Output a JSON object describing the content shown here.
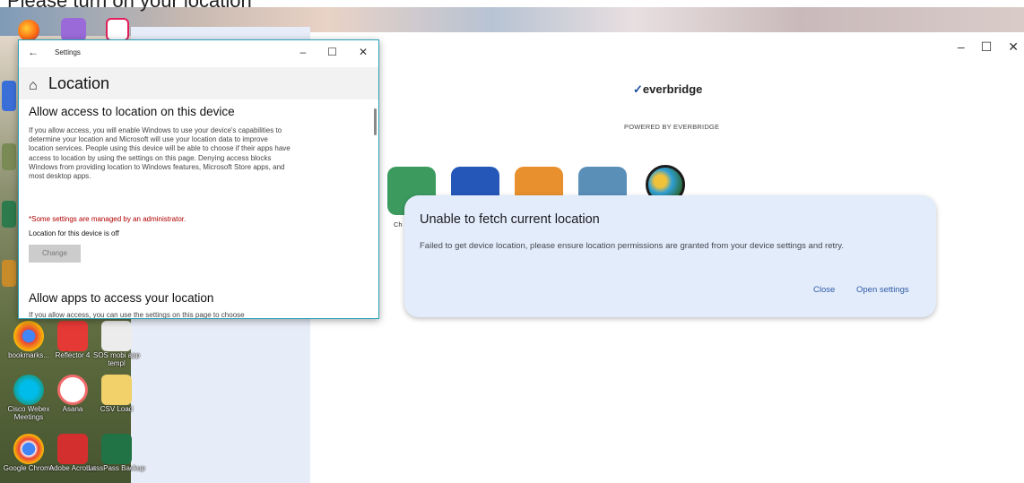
{
  "desktop": {
    "top_cut_text": "Please turn on your location",
    "icons": [
      {
        "label": "bookmarks...",
        "color": "#f4b400"
      },
      {
        "label": "Reflector 4",
        "color": "#e53935"
      },
      {
        "label": "SOS mobi app templ",
        "color": "#eaeaea"
      },
      {
        "label": "Cisco Webex Meetings",
        "color": "#2e7d32"
      },
      {
        "label": "Asana",
        "color": "#f06a6a"
      },
      {
        "label": "CSV Load",
        "color": "#f2d16b"
      },
      {
        "label": "Google Chrome",
        "color": "#4285f4"
      },
      {
        "label": "Adobe Acrobat",
        "color": "#d32f2f"
      },
      {
        "label": "LassPass Backup",
        "color": "#217346"
      }
    ]
  },
  "settings_window": {
    "title": "Settings",
    "back_icon": "←",
    "minimize_icon": "–",
    "maximize_icon": "☐",
    "close_icon": "✕",
    "home_icon": "⌂",
    "page_title": "Location",
    "section1_heading": "Allow access to location on this device",
    "section1_text": "If you allow access, you will enable Windows to use your device's capabilities to determine your location and Microsoft will use your location data to improve location services. People using this device will be able to choose if their apps have access to location by using the settings on this page. Denying access blocks Windows from providing location to Windows features, Microsoft Store apps, and most desktop apps.",
    "admin_warning": "*Some settings are managed by an administrator.",
    "device_status": "Location for this device is off",
    "change_button": "Change",
    "section2_heading": "Allow apps to access your location",
    "section2_text_cut": "If you allow access, you can use the settings on this page to choose"
  },
  "app_window": {
    "logo_text": "everbridge",
    "powered_by": "POWERED BY EVERBRIDGE",
    "minimize_icon": "–",
    "maximize_icon": "☐",
    "close_icon": "✕",
    "tile_colors": [
      "#3c9a5f",
      "#2457b8",
      "#e8902e",
      "#5a8fb8"
    ],
    "globe_color": "#2b6b3a",
    "partial_label": "Ch"
  },
  "dialog": {
    "title": "Unable to fetch current location",
    "message": "Failed to get device location, please ensure location permissions are granted from your device settings and retry.",
    "close_button": "Close",
    "open_settings_button": "Open settings"
  }
}
